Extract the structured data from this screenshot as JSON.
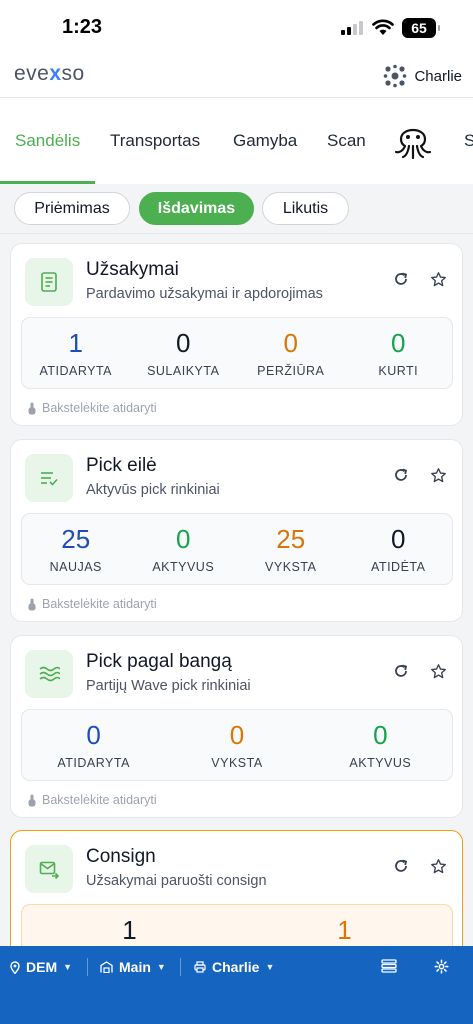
{
  "status_bar": {
    "time": "1:23",
    "battery": "65"
  },
  "header": {
    "logo_pre": "eve",
    "logo_x": "x",
    "logo_post": "so",
    "user": "Charlie"
  },
  "nav": {
    "tabs": [
      "Sandėlis",
      "Transportas",
      "Gamyba",
      "Scan",
      "S"
    ],
    "active": "Sandėlis"
  },
  "subtabs": [
    "Priėmimas",
    "Išdavimas",
    "Likutis"
  ],
  "colors": {
    "accent": "#4caf50",
    "blue": "#1e4db7",
    "green": "#16a34a",
    "orange": "#d97706",
    "black": "#111827",
    "bottom_bar": "#1565c0"
  },
  "cards": [
    {
      "title": "Užsakymai",
      "subtitle": "Pardavimo užsakymai ir apdorojimas",
      "icon": "document-icon",
      "stats": [
        {
          "value": "1",
          "label": "ATIDARYTA",
          "color": "#1e4db7"
        },
        {
          "value": "0",
          "label": "SULAIKYTA",
          "color": "#111827"
        },
        {
          "value": "0",
          "label": "PERŽIŪRA",
          "color": "#d97706"
        },
        {
          "value": "0",
          "label": "KURTI",
          "color": "#16a34a"
        }
      ],
      "hint": "Bakstelėkite atidaryti"
    },
    {
      "title": "Pick eilė",
      "subtitle": "Aktyvūs pick rinkiniai",
      "icon": "list-check-icon",
      "stats": [
        {
          "value": "25",
          "label": "NAUJAS",
          "color": "#1e4db7"
        },
        {
          "value": "0",
          "label": "AKTYVUS",
          "color": "#16a34a"
        },
        {
          "value": "25",
          "label": "VYKSTA",
          "color": "#d97706"
        },
        {
          "value": "0",
          "label": "ATIDĖTA",
          "color": "#111827"
        }
      ],
      "hint": "Bakstelėkite atidaryti"
    },
    {
      "title": "Pick pagal bangą",
      "subtitle": "Partijų Wave pick rinkiniai",
      "icon": "wave-icon",
      "stats": [
        {
          "value": "0",
          "label": "ATIDARYTA",
          "color": "#1e4db7"
        },
        {
          "value": "0",
          "label": "VYKSTA",
          "color": "#d97706"
        },
        {
          "value": "0",
          "label": "AKTYVUS",
          "color": "#16a34a"
        }
      ],
      "hint": "Bakstelėkite atidaryti"
    },
    {
      "title": "Consign",
      "subtitle": "Užsakymai paruošti consign",
      "icon": "mail-forward-icon",
      "stats": [
        {
          "value": "1",
          "label": "",
          "color": "#111827"
        },
        {
          "value": "1",
          "label": "",
          "color": "#d97706"
        }
      ]
    }
  ],
  "bottom_bar": {
    "location": "DEM",
    "warehouse": "Main",
    "user": "Charlie"
  }
}
